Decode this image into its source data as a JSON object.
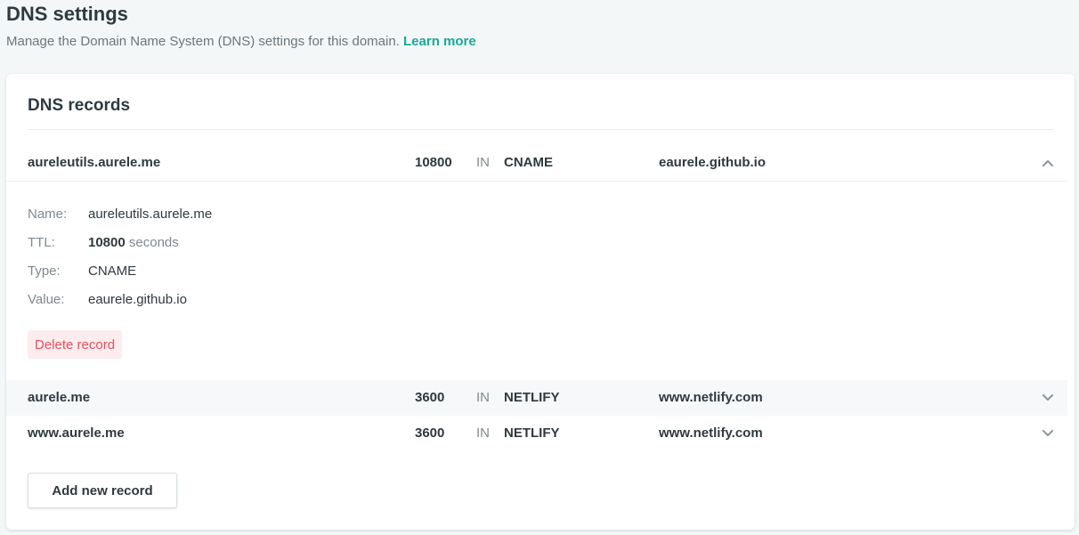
{
  "header": {
    "title": "DNS settings",
    "description": "Manage the Domain Name System (DNS) settings for this domain.",
    "learn_more": "Learn more"
  },
  "card": {
    "title": "DNS records"
  },
  "records": [
    {
      "name": "aureleutils.aurele.me",
      "ttl": "10800",
      "class": "IN",
      "type": "CNAME",
      "value": "eaurele.github.io",
      "expanded": true
    },
    {
      "name": "aurele.me",
      "ttl": "3600",
      "class": "IN",
      "type": "NETLIFY",
      "value": "www.netlify.com",
      "expanded": false
    },
    {
      "name": "www.aurele.me",
      "ttl": "3600",
      "class": "IN",
      "type": "NETLIFY",
      "value": "www.netlify.com",
      "expanded": false
    }
  ],
  "details": {
    "name_label": "Name:",
    "name_value": "aureleutils.aurele.me",
    "ttl_label": "TTL:",
    "ttl_value": "10800",
    "ttl_unit": "seconds",
    "type_label": "Type:",
    "type_value": "CNAME",
    "value_label": "Value:",
    "value_value": "eaurele.github.io",
    "delete_label": "Delete record"
  },
  "actions": {
    "add_label": "Add new record"
  },
  "icons": {
    "expanded_chevron": "chevron-up-icon",
    "collapsed_chevron": "chevron-down-icon"
  },
  "colors": {
    "accent": "#15a99a",
    "danger": "#e2505f",
    "danger_bg": "#fdeced",
    "text": "#2e3a3f",
    "muted": "#7d8a8f"
  }
}
